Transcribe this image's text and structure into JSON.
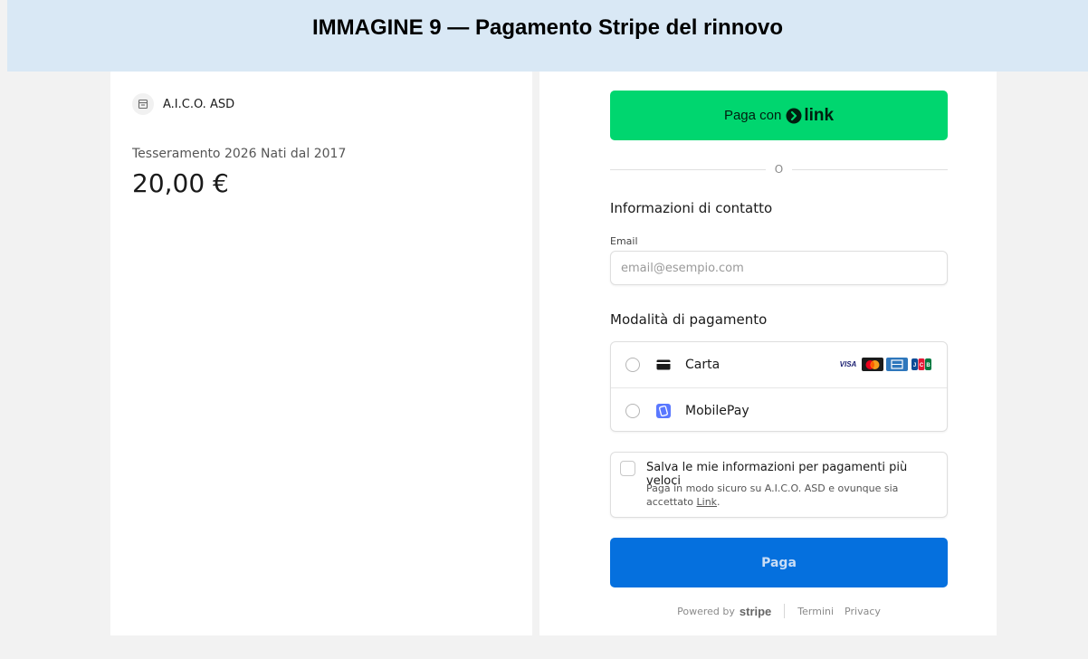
{
  "banner": {
    "title": "IMMAGINE 9 — Pagamento Stripe del rinnovo"
  },
  "summary": {
    "merchant_name": "A.I.C.O. ASD",
    "product_name": "Tesseramento 2026 Nati dal 2017",
    "price": "20,00 €"
  },
  "checkout": {
    "link_button": {
      "label": "Paga con",
      "brand": "link"
    },
    "divider_text": "O",
    "contact_title": "Informazioni di contatto",
    "email_label": "Email",
    "email_placeholder": "email@esempio.com",
    "email_value": "",
    "payment_title": "Modalità di pagamento",
    "methods": [
      {
        "label": "Carta",
        "icon": "card-icon",
        "brands": [
          "visa",
          "mastercard",
          "amex",
          "jcb"
        ]
      },
      {
        "label": "MobilePay",
        "icon": "mobilepay-icon"
      }
    ],
    "save_info": {
      "title": "Salva le mie informazioni per pagamenti più veloci",
      "desc_prefix": "Paga in modo sicuro su A.I.C.O. ASD e ovunque sia accettato ",
      "link_text": "Link",
      "desc_suffix": "."
    },
    "pay_button_label": "Paga",
    "footer": {
      "powered_by": "Powered by",
      "stripe": "stripe",
      "terms": "Termini",
      "privacy": "Privacy"
    }
  },
  "colors": {
    "link_green": "#00d66f",
    "pay_blue": "#0570de",
    "banner_bg": "#d9e8f5"
  }
}
